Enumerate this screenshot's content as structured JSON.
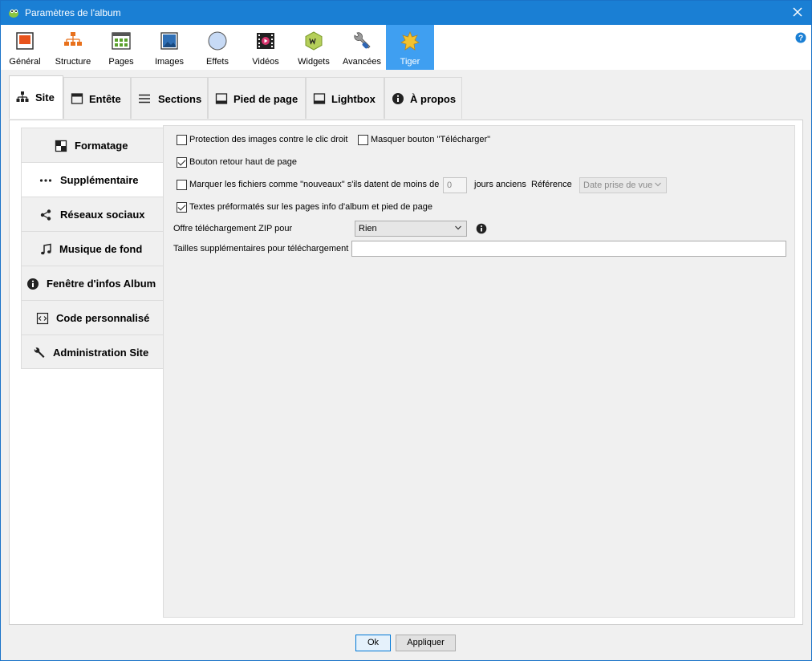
{
  "window": {
    "title": "Paramètres de l'album"
  },
  "toolbar": {
    "items": [
      {
        "label": "Général",
        "icon": "general-icon"
      },
      {
        "label": "Structure",
        "icon": "structure-icon"
      },
      {
        "label": "Pages",
        "icon": "pages-icon"
      },
      {
        "label": "Images",
        "icon": "images-icon"
      },
      {
        "label": "Effets",
        "icon": "effects-icon"
      },
      {
        "label": "Vidéos",
        "icon": "video-icon"
      },
      {
        "label": "Widgets",
        "icon": "widgets-icon"
      },
      {
        "label": "Avancées",
        "icon": "advanced-icon"
      },
      {
        "label": "Tiger",
        "icon": "tiger-icon"
      }
    ],
    "active": "Tiger"
  },
  "tabs": {
    "items": [
      {
        "label": "Site"
      },
      {
        "label": "Entête"
      },
      {
        "label": "Sections"
      },
      {
        "label": "Pied de page"
      },
      {
        "label": "Lightbox"
      },
      {
        "label": "À propos"
      }
    ],
    "active": "Site"
  },
  "sidebar": {
    "items": [
      {
        "label": "Formatage"
      },
      {
        "label": "Supplémentaire"
      },
      {
        "label": "Réseaux sociaux"
      },
      {
        "label": "Musique de fond"
      },
      {
        "label": "Fenêtre d'infos Album"
      },
      {
        "label": "Code personnalisé"
      },
      {
        "label": "Administration Site"
      }
    ],
    "active": "Supplémentaire"
  },
  "form": {
    "protect_images": {
      "label": "Protection des images contre le clic droit",
      "checked": false
    },
    "hide_download": {
      "label": "Masquer bouton \"Télécharger\"",
      "checked": false
    },
    "back_to_top": {
      "label": "Bouton retour haut de page",
      "checked": true
    },
    "mark_new": {
      "label": "Marquer les fichiers comme \"nouveaux\" s'ils datent de moins de",
      "checked": false
    },
    "days_value": "0",
    "days_suffix": "jours anciens",
    "reference_label": "Référence",
    "reference_value": "Date prise de vue",
    "preformatted": {
      "label": "Textes préformatés sur les pages info d'album et pied de page",
      "checked": true
    },
    "zip_label": "Offre téléchargement ZIP pour",
    "zip_value": "Rien",
    "extra_sizes_label": "Tailles supplémentaires pour téléchargement",
    "extra_sizes_value": ""
  },
  "footer": {
    "ok": "Ok",
    "apply": "Appliquer"
  }
}
